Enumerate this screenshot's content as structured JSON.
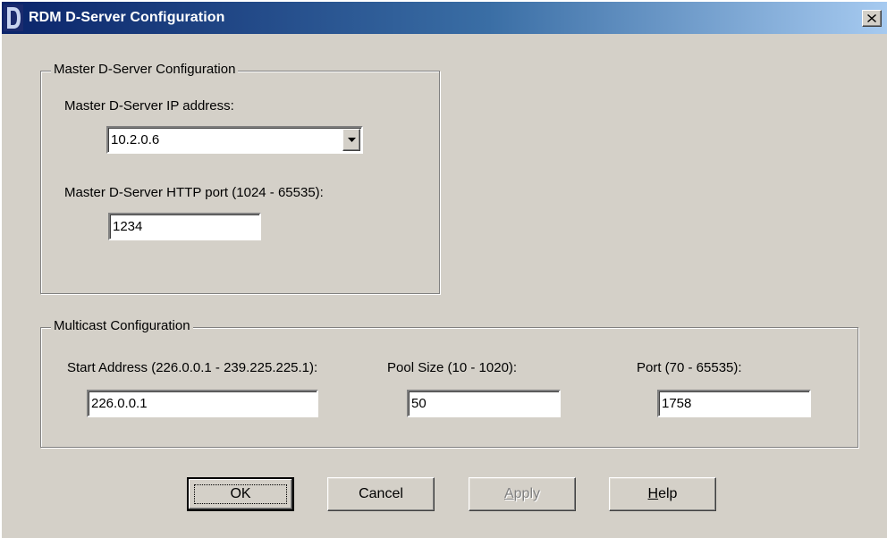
{
  "window": {
    "title": "RDM D-Server Configuration",
    "close_glyph": "✕"
  },
  "master_group": {
    "legend": "Master D-Server Configuration",
    "ip_label": "Master D-Server IP address:",
    "ip_value": "10.2.0.6",
    "port_label": "Master D-Server HTTP port (1024 - 65535):",
    "port_value": "1234"
  },
  "multicast_group": {
    "legend": "Multicast Configuration",
    "start_label": "Start Address (226.0.0.1 - 239.225.225.1):",
    "start_value": "226.0.0.1",
    "pool_label": "Pool Size (10 - 1020):",
    "pool_value": "50",
    "port_label": "Port (70 - 65535):",
    "port_value": "1758"
  },
  "buttons": {
    "ok": "OK",
    "cancel": "Cancel",
    "apply_mnemonic": "A",
    "apply_rest": "pply",
    "help_mnemonic": "H",
    "help_rest": "elp"
  },
  "icons": {
    "app": "app-logo-icon",
    "close": "close-icon",
    "dropdown": "chevron-down-icon"
  },
  "colors": {
    "face": "#d4d0c8",
    "title_start": "#0a246a",
    "title_end": "#a6caf0",
    "disabled_text": "#808080"
  }
}
